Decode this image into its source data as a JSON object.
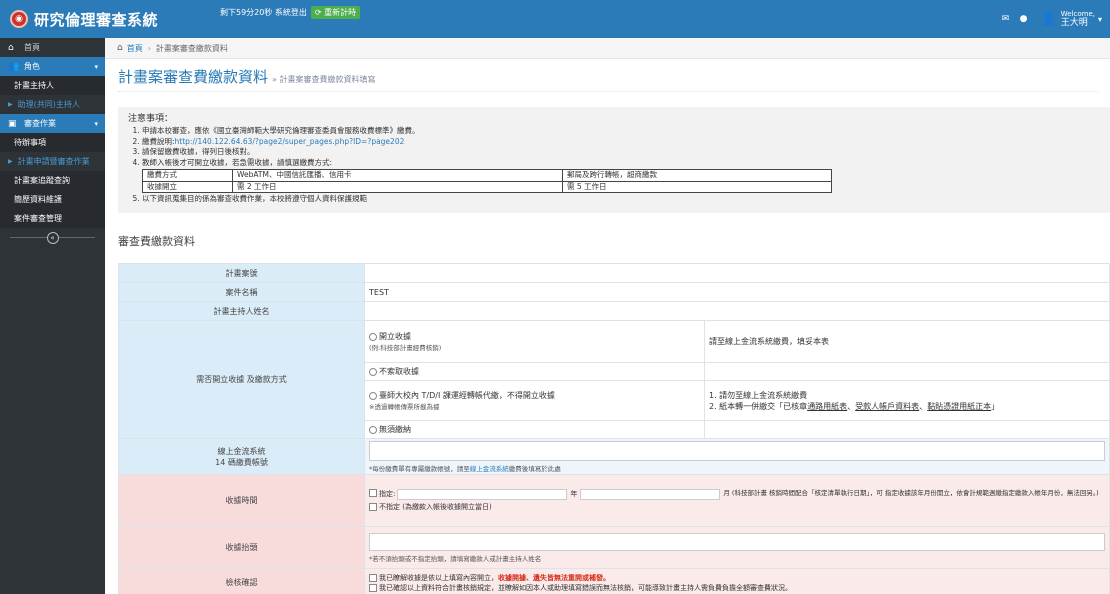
{
  "header": {
    "logo_glyph": "◉",
    "app_title": "研究倫理審查系統",
    "session_text": "剩下59分20秒 系統登出",
    "refresh_label": "重新計時",
    "mail_icon": "envelope-icon",
    "user_welcome": "Welcome,",
    "user_name": "王大明"
  },
  "sidebar": {
    "items": [
      {
        "label": "首頁",
        "icon": "home-icon",
        "type": "top"
      },
      {
        "label": "角色",
        "icon": "users-icon",
        "type": "parent"
      },
      {
        "label": "計畫主持人",
        "type": "child"
      },
      {
        "label": "助理(共同)主持人",
        "type": "link"
      },
      {
        "label": "審查作業",
        "icon": "briefcase-icon",
        "type": "parent"
      },
      {
        "label": "待辦事項",
        "type": "child"
      },
      {
        "label": "計畫申請暨審查作業",
        "type": "link"
      },
      {
        "label": "計畫案追蹤查詢",
        "type": "child"
      },
      {
        "label": "簡歷資料維護",
        "type": "child"
      },
      {
        "label": "案件審查管理",
        "type": "child"
      }
    ]
  },
  "breadcrumb": {
    "home": "首頁",
    "current": "計畫案審查繳款資料"
  },
  "page": {
    "title": "計畫案審查費繳款資料",
    "subtitle": "» 計畫案審查費繳款資料填寫"
  },
  "notice": {
    "title": "注意事項：",
    "items": [
      "申請本校審查，應依《國立臺灣師範大學研究倫理審查委員會服務收費標準》繳費。",
      "繳費說明:",
      "請保留繳費收據，得列日後核對。",
      "教師入帳後才可開立收據，若急需收據，請慎選繳費方式:",
      "以下資訊蒐集目的係為審查收費作業，本校將遵守個人資料保護規範"
    ],
    "link_text": "http://140.122.64.63/?page2/super_pages.php?ID=?page202",
    "table": [
      [
        "繳費方式",
        "WebATM、中國信託匯播、信用卡",
        "郵局及跨行轉帳，超商繳款"
      ],
      [
        "收據開立",
        "需 2 工作日",
        "需 5 工作日"
      ]
    ]
  },
  "section_title": "審查費繳款資料",
  "form": {
    "plan_no_label": "計畫案號",
    "case_name_label": "案件名稱",
    "case_name_value": "TEST",
    "pi_label": "計畫主持人姓名",
    "method_label": "需否開立收據 及繳款方式",
    "opt1": "開立收據",
    "opt1_note": "(例:科技部計畫經費核銷)",
    "opt1_right": "請至線上金流系統繳費，填妥本表",
    "opt2": "不索取收據",
    "opt3": "臺師大校內 T/D/I 課運經轉帳代繳，不得開立收據",
    "opt3_note": "※透過轉帳傳票所載為據",
    "opt3_right1": "1. 請勿至線上金流系統繳費",
    "opt3_right2_prefix": "2. 紙本轉一併繳交「已核章",
    "opt3_right2_u1": "通路用紙表",
    "opt3_right2_mid1": "、",
    "opt3_right2_u2": "受款人帳戶資料表",
    "opt3_right2_mid2": "、",
    "opt3_right2_u3": "黏貼憑證用紙正本",
    "opt3_right2_suffix": "」",
    "opt4": "無須繳納",
    "online_label1": "線上金流系統",
    "online_label2": "14 碼繳費帳號",
    "online_note_pre": "*每份繳費單有專屬繳款帳號，請至",
    "online_note_link": "線上金流系統",
    "online_note_post": "繳費後填寫於此處",
    "receipt_date_label": "收據時間",
    "designate": "指定:",
    "year": "年",
    "month_note": "月 (科技部計畫 核銷時間配合「核定清單執行日期」，可 指定收據該年月份開立，依會計規範週繳指定繳款入帳年月份，無法回另。)",
    "not_designate": "不指定 (為繳款入帳後收據開立當日)",
    "receipt_title_label": "收據抬頭",
    "receipt_title_note": "*若不須抬頭或不指定抬頭，請填寫繳款人或計畫主持人姓名",
    "confirm_label": "檢核確認",
    "confirm1_pre": "我已瞭解收據是依以上填寫內容開立，",
    "confirm1_red": "收據開據、遺失皆無法重開或補發。",
    "confirm2": "我已確認以上資料符合計畫核銷規定，並瞭解如因本人或助理填寫錯誤而無法核銷，可能導致計畫主持人需負費負擔全額審查費狀況。"
  },
  "colors": {
    "brand_blue": "#2b7bb9",
    "sidebar_bg": "#2e3338",
    "label_blue": "#d9ecf7",
    "label_pink": "#f8dcdc",
    "alert_red": "#d62c1a"
  }
}
